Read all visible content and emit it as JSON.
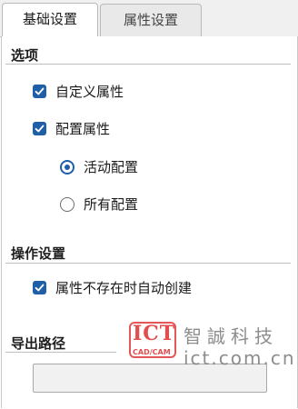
{
  "tabs": [
    {
      "label": "基础设置",
      "active": true
    },
    {
      "label": "属性设置",
      "active": false
    }
  ],
  "options_group": {
    "title": "选项",
    "custom_attributes": {
      "label": "自定义属性",
      "checked": true
    },
    "config_attributes": {
      "label": "配置属性",
      "checked": true
    },
    "active_config": {
      "label": "活动配置",
      "selected": true
    },
    "all_configs": {
      "label": "所有配置",
      "selected": false
    }
  },
  "operation_group": {
    "title": "操作设置",
    "auto_create": {
      "label": "属性不存在时自动创建",
      "checked": true
    }
  },
  "export_group": {
    "title": "导出路径",
    "path_value": ""
  },
  "watermark": {
    "logo": "ICT",
    "sub": "CAD/CAM",
    "name": "智誠科技",
    "url": "ict.com.cn"
  },
  "colors": {
    "accent": "#1f5fa8",
    "watermark_red": "#e03a3a"
  }
}
